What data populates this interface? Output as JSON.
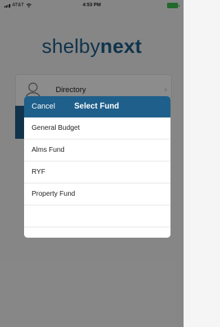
{
  "status_bar": {
    "carrier": "AT&T",
    "time": "4:53 PM"
  },
  "brand": {
    "logo_light": "shelby",
    "logo_bold": "next"
  },
  "home": {
    "directory_label": "Directory",
    "chevron": "›"
  },
  "picker": {
    "cancel_label": "Cancel",
    "title": "Select Fund",
    "items": [
      "General Budget",
      "Alms Fund",
      "RYF",
      "Property Fund",
      "",
      ""
    ]
  },
  "colors": {
    "brand_blue": "#1f5f8b",
    "battery_green": "#3fbf4f"
  },
  "icons": {
    "wifi": "wifi-icon",
    "signal": "signal-icon",
    "battery": "battery-icon",
    "person": "person-icon",
    "chevron": "chevron-right-icon"
  }
}
